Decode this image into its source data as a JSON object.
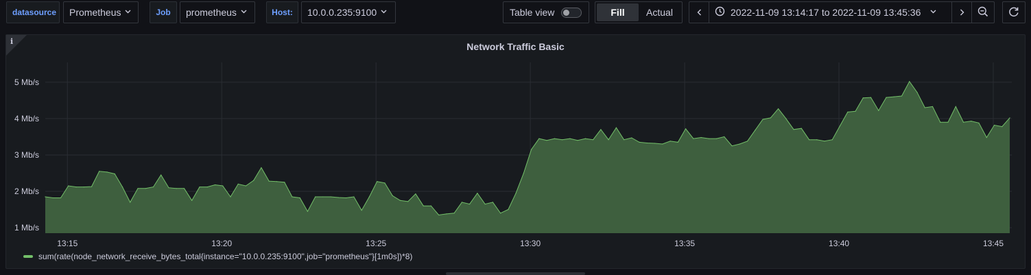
{
  "toolbar": {
    "datasource_label": "datasource",
    "datasource_value": "Prometheus",
    "job_label": "Job",
    "job_value": "prometheus",
    "host_label": "Host:",
    "host_value": "10.0.0.235:9100",
    "table_view_label": "Table view",
    "fill_label": "Fill",
    "actual_label": "Actual",
    "time_range": "2022-11-09 13:14:17 to 2022-11-09 13:45:36"
  },
  "icons": {
    "dropdown": "chevron-down-icon",
    "time_back": "chevron-left-icon",
    "time_forward": "chevron-right-icon",
    "clock": "clock-icon",
    "zoom_out": "zoom-out-icon",
    "refresh": "refresh-icon",
    "info": "info-icon"
  },
  "colors": {
    "series_line": "#73bf69",
    "series_fill": "#3e5f3e",
    "label_accent": "#6e9fff",
    "background": "#111217",
    "panel": "#181b1f"
  },
  "panel": {
    "title": "Network Traffic Basic"
  },
  "chart_data": {
    "type": "area",
    "title": "Network Traffic Basic",
    "xlabel": "",
    "ylabel": "",
    "xticks": [
      "13:15",
      "13:20",
      "13:25",
      "13:30",
      "13:35",
      "13:40",
      "13:45"
    ],
    "yticks": [
      "1 Mb/s",
      "2 Mb/s",
      "3 Mb/s",
      "4 Mb/s",
      "5 Mb/s"
    ],
    "ylim": [
      0.85,
      5.45
    ],
    "xlim": [
      "13:14:17",
      "13:45:36"
    ],
    "grid": true,
    "legend_position": "bottom-left",
    "series": [
      {
        "name": "sum(rate(node_network_receive_bytes_total{instance=\"10.0.0.235:9100\",job=\"prometheus\"}[1m0s])*8)",
        "x": [
          "13:14:17",
          "13:14:32",
          "13:14:47",
          "13:15:02",
          "13:15:17",
          "13:15:32",
          "13:15:47",
          "13:16:02",
          "13:16:17",
          "13:16:32",
          "13:16:47",
          "13:17:02",
          "13:17:17",
          "13:17:32",
          "13:17:47",
          "13:18:02",
          "13:18:17",
          "13:18:32",
          "13:18:47",
          "13:19:02",
          "13:19:17",
          "13:19:32",
          "13:19:47",
          "13:20:02",
          "13:20:17",
          "13:20:32",
          "13:20:47",
          "13:21:02",
          "13:21:17",
          "13:21:32",
          "13:21:47",
          "13:22:02",
          "13:22:17",
          "13:22:32",
          "13:22:47",
          "13:23:02",
          "13:23:17",
          "13:23:32",
          "13:23:47",
          "13:24:02",
          "13:24:17",
          "13:24:32",
          "13:24:47",
          "13:25:02",
          "13:25:17",
          "13:25:32",
          "13:25:47",
          "13:26:02",
          "13:26:17",
          "13:26:32",
          "13:26:47",
          "13:27:02",
          "13:27:17",
          "13:27:32",
          "13:27:47",
          "13:28:02",
          "13:28:17",
          "13:28:32",
          "13:28:47",
          "13:29:02",
          "13:29:17",
          "13:29:32",
          "13:29:47",
          "13:30:02",
          "13:30:17",
          "13:30:32",
          "13:30:47",
          "13:31:02",
          "13:31:17",
          "13:31:32",
          "13:31:47",
          "13:32:02",
          "13:32:17",
          "13:32:32",
          "13:32:47",
          "13:33:02",
          "13:33:17",
          "13:33:32",
          "13:33:47",
          "13:34:02",
          "13:34:17",
          "13:34:32",
          "13:34:47",
          "13:35:02",
          "13:35:17",
          "13:35:32",
          "13:35:47",
          "13:36:02",
          "13:36:17",
          "13:36:32",
          "13:36:47",
          "13:37:02",
          "13:37:17",
          "13:37:32",
          "13:37:47",
          "13:38:02",
          "13:38:17",
          "13:38:32",
          "13:38:47",
          "13:39:02",
          "13:39:17",
          "13:39:32",
          "13:39:47",
          "13:40:02",
          "13:40:17",
          "13:40:32",
          "13:40:47",
          "13:41:02",
          "13:41:17",
          "13:41:32",
          "13:41:47",
          "13:42:02",
          "13:42:17",
          "13:42:32",
          "13:42:47",
          "13:43:02",
          "13:43:17",
          "13:43:32",
          "13:43:47",
          "13:44:02",
          "13:44:17",
          "13:44:32",
          "13:44:47",
          "13:45:02",
          "13:45:17",
          "13:45:32"
        ],
        "values": [
          1.85,
          1.82,
          1.82,
          2.15,
          2.12,
          2.12,
          2.13,
          2.55,
          2.53,
          2.48,
          2.12,
          1.7,
          2.08,
          2.08,
          2.12,
          2.45,
          2.1,
          2.08,
          2.08,
          1.75,
          2.12,
          2.12,
          2.18,
          2.15,
          1.85,
          2.2,
          2.15,
          2.3,
          2.65,
          2.28,
          2.27,
          2.25,
          1.85,
          1.82,
          1.45,
          1.85,
          1.85,
          1.85,
          1.83,
          1.82,
          1.85,
          1.48,
          1.85,
          2.27,
          2.23,
          1.88,
          1.75,
          1.72,
          1.93,
          1.6,
          1.6,
          1.35,
          1.38,
          1.4,
          1.7,
          1.65,
          1.95,
          1.65,
          1.7,
          1.4,
          1.5,
          1.95,
          2.5,
          3.15,
          3.45,
          3.4,
          3.45,
          3.42,
          3.45,
          3.4,
          3.45,
          3.42,
          3.7,
          3.42,
          3.75,
          3.42,
          3.47,
          3.35,
          3.33,
          3.32,
          3.3,
          3.38,
          3.35,
          3.72,
          3.45,
          3.48,
          3.45,
          3.45,
          3.5,
          3.25,
          3.3,
          3.38,
          3.68,
          3.98,
          4.02,
          4.27,
          4.0,
          3.7,
          3.73,
          3.42,
          3.42,
          3.38,
          3.42,
          3.8,
          4.18,
          4.2,
          4.57,
          4.58,
          4.22,
          4.58,
          4.6,
          4.62,
          5.02,
          4.72,
          4.3,
          4.33,
          3.9,
          3.9,
          4.33,
          3.9,
          3.93,
          3.88,
          3.48,
          3.82,
          3.78,
          4.02
        ]
      }
    ]
  },
  "legend": {
    "entries": [
      "sum(rate(node_network_receive_bytes_total{instance=\"10.0.0.235:9100\",job=\"prometheus\"}[1m0s])*8)"
    ]
  }
}
